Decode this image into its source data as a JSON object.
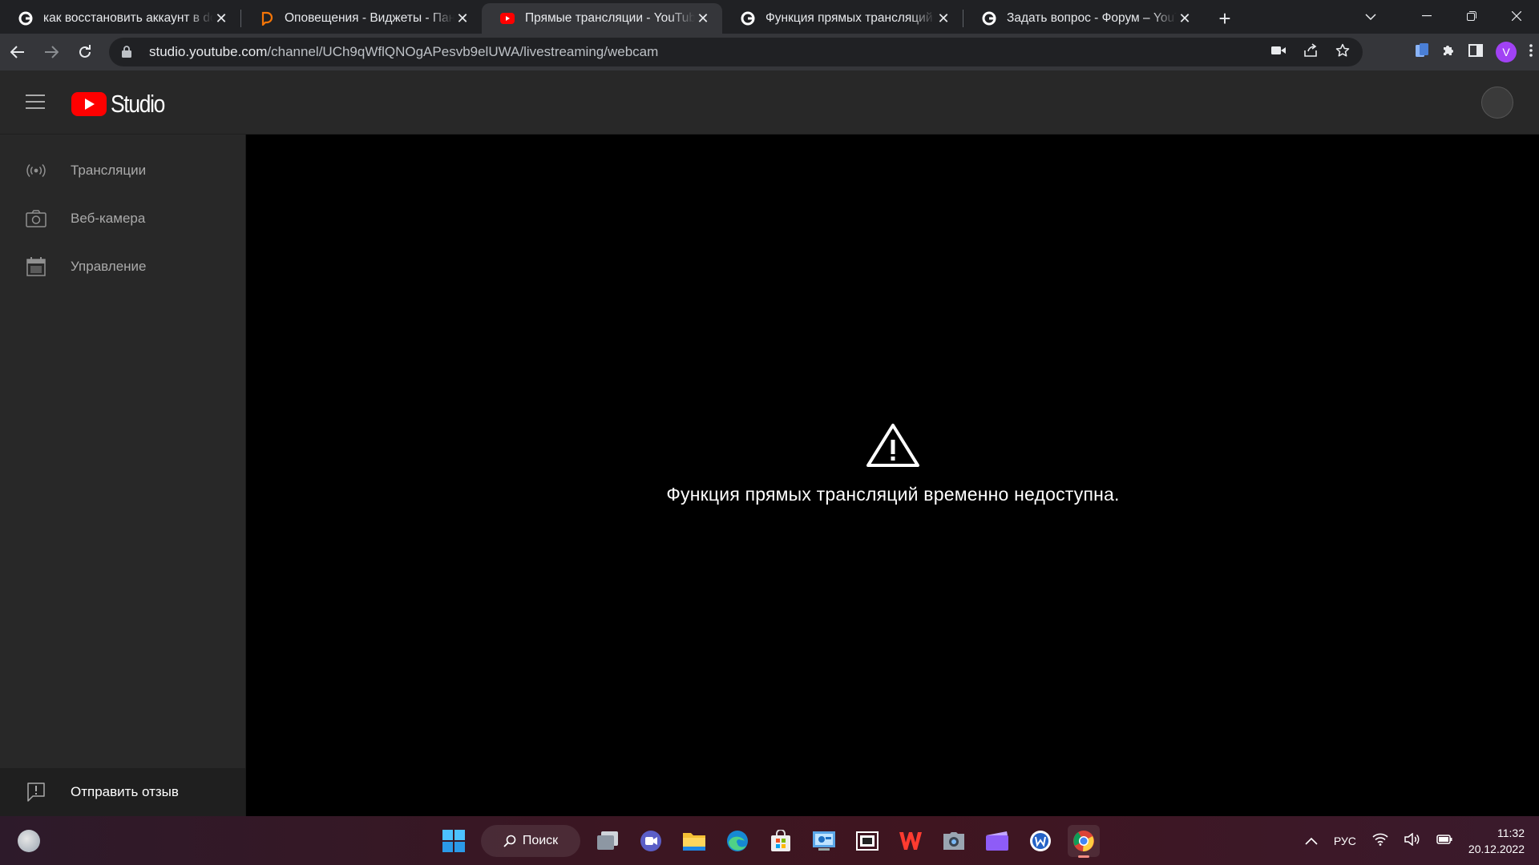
{
  "browser": {
    "tabs": [
      {
        "title": "как восстановить аккаунт в donationalerts",
        "icon": "google-icon",
        "active": false
      },
      {
        "title": "Оповещения - Виджеты - Панель управления",
        "icon": "donationalerts-icon",
        "active": false
      },
      {
        "title": "Прямые трансляции - YouTube Studio",
        "icon": "youtube-icon",
        "active": true
      },
      {
        "title": "Функция прямых трансляций временно недоступна",
        "icon": "google-icon",
        "active": false
      },
      {
        "title": "Задать вопрос - Форум – YouTube",
        "icon": "google-icon",
        "active": false
      }
    ],
    "url_host": "studio.youtube.com",
    "url_path": "/channel/UCh9qWflQNOgAPesvb9elUWA/livestreaming/webcam",
    "profile_letter": "V"
  },
  "studio": {
    "logo_text": "Studio",
    "nav": [
      {
        "label": "Трансляции",
        "icon": "broadcast-icon"
      },
      {
        "label": "Веб-камера",
        "icon": "camera-icon"
      },
      {
        "label": "Управление",
        "icon": "calendar-icon"
      }
    ],
    "feedback_label": "Отправить отзыв",
    "message": "Функция прямых трансляций временно недоступна."
  },
  "taskbar": {
    "search_label": "Поиск",
    "language": "РУС",
    "time": "11:32",
    "date": "20.12.2022"
  },
  "colors": {
    "yt_red": "#ff0000",
    "studio_surface": "#282828",
    "chrome_dark": "#202124",
    "chrome_toolbar": "#35363a"
  }
}
